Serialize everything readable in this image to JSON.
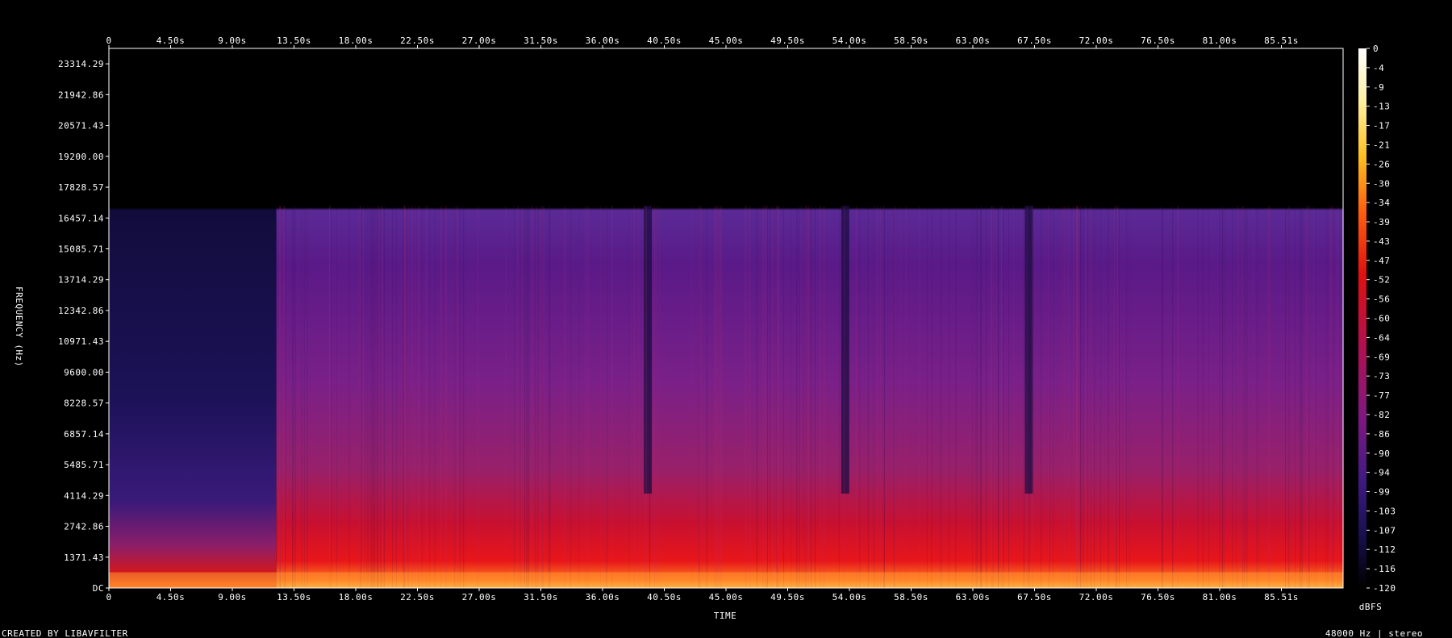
{
  "chart_data": {
    "type": "heatmap",
    "description_kind": "spectrogram",
    "xlabel": "TIME",
    "ylabel": "FREQUENCY (Hz)",
    "x_ticks": [
      "0",
      "4.50s",
      "9.00s",
      "13.50s",
      "18.00s",
      "22.50s",
      "27.00s",
      "31.50s",
      "36.00s",
      "40.50s",
      "45.00s",
      "49.50s",
      "54.00s",
      "58.50s",
      "63.00s",
      "67.50s",
      "72.00s",
      "76.50s",
      "81.00s",
      "85.51s"
    ],
    "y_ticks": [
      "DC",
      "1371.43",
      "2742.86",
      "4114.29",
      "5485.71",
      "6857.14",
      "8228.57",
      "9600.00",
      "10971.43",
      "12342.86",
      "13714.29",
      "15085.71",
      "16457.14",
      "17828.57",
      "19200.00",
      "20571.43",
      "21942.86",
      "23314.29"
    ],
    "y_range_hz": [
      0,
      24000
    ],
    "x_range_s": [
      0,
      90
    ],
    "colorbar": {
      "unit": "dBFS",
      "ticks": [
        "0",
        "-4",
        "-9",
        "-13",
        "-17",
        "-21",
        "-26",
        "-30",
        "-34",
        "-39",
        "-43",
        "-47",
        "-52",
        "-56",
        "-60",
        "-64",
        "-69",
        "-73",
        "-77",
        "-82",
        "-86",
        "-90",
        "-94",
        "-99",
        "-103",
        "-107",
        "-112",
        "-116",
        "-120"
      ],
      "range": [
        -120,
        0
      ]
    },
    "footer_left": "CREATED BY LIBAVFILTER",
    "footer_right": "48000 Hz | stereo",
    "features": {
      "cutoff_hz": 17000,
      "quiet_intro_end_s": 12.2,
      "dips_s": [
        39.0,
        53.4,
        66.8
      ]
    }
  }
}
